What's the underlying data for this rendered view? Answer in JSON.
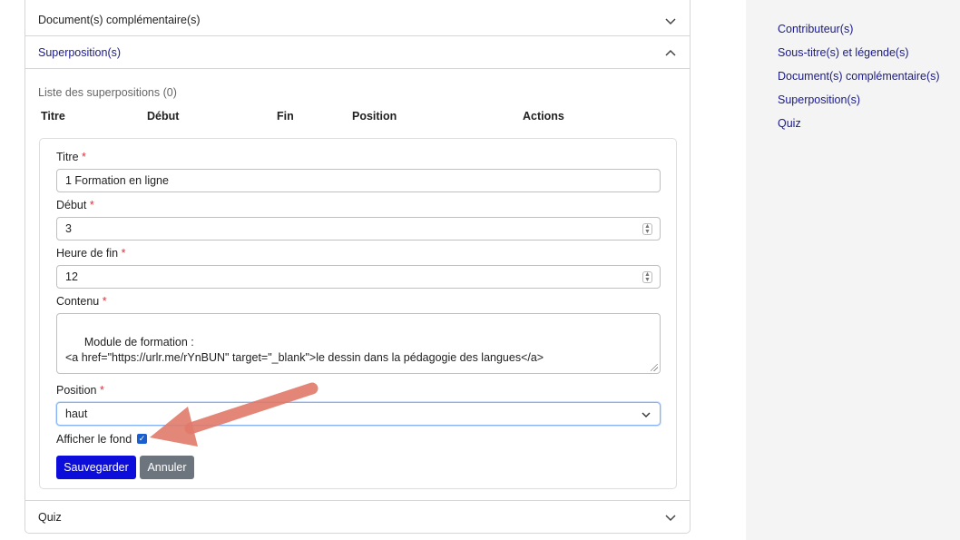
{
  "accordion": {
    "sections": [
      {
        "label": "Document(s) complémentaire(s)",
        "icon": "chevron-down-icon"
      },
      {
        "label": "Superposition(s)",
        "icon": "chevron-up-icon"
      },
      {
        "label": "Quiz",
        "icon": "chevron-down-icon"
      }
    ]
  },
  "overlays": {
    "list_label": "Liste des superpositions (0)",
    "columns": [
      "Titre",
      "Début",
      "Fin",
      "Position",
      "Actions"
    ]
  },
  "form": {
    "required_mark": "*",
    "title_label": "Titre",
    "title_value": "1 Formation en ligne",
    "start_label": "Début",
    "start_value": "3",
    "end_label": "Heure de fin",
    "end_value": "12",
    "content_label": "Contenu",
    "content_value": "Module de formation :\n<a href=\"https://urlr.me/rYnBUN\" target=\"_blank\">le dessin dans la pédagogie des langues</a>",
    "position_label": "Position",
    "position_value": "haut",
    "show_background_label": "Afficher le fond",
    "show_background_checked": true,
    "save_label": "Sauvegarder",
    "cancel_label": "Annuler"
  },
  "sidebar": {
    "items": [
      "Contributeur(s)",
      "Sous-titre(s) et légende(s)",
      "Document(s) complémentaire(s)",
      "Superposition(s)",
      "Quiz"
    ]
  },
  "colors": {
    "link": "#1a1a8c",
    "primary_button": "#0d0ddb",
    "secondary_button": "#6c757d",
    "arrow": "#e07a6a",
    "checkbox": "#1a5fd0"
  }
}
